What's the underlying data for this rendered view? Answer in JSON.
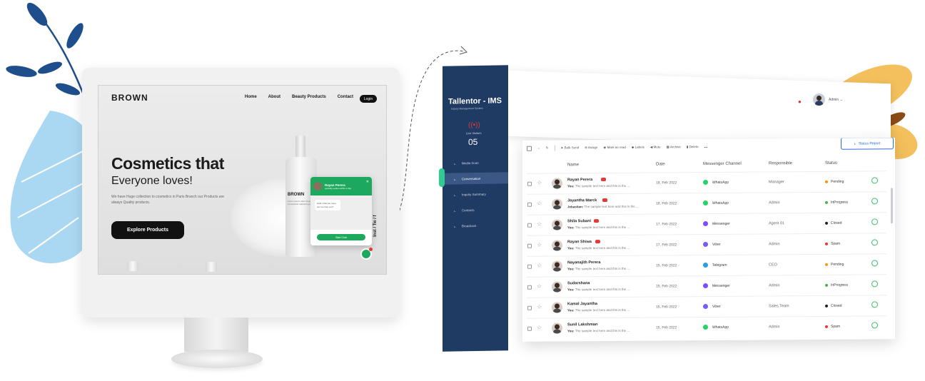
{
  "website": {
    "brand": "BROWN",
    "nav": [
      "Home",
      "About",
      "Beauty Products",
      "Contact"
    ],
    "login": "Login",
    "hero_title": "Cosmetics that",
    "hero_subtitle": "Everyone loves!",
    "hero_desc": "We have Huge collection to cosmetics in Paris Branch our Products are always Quality products.",
    "cta": "Explore Products",
    "bottle_label": "BROWN",
    "bottle_text": "Lorem ipsum dolor sit amet consectetur adipiscing elit",
    "chat": {
      "name": "Rayan Perera",
      "status": "typically replies within a day",
      "message": "Hello Channel, How can we help you?",
      "start": "Start Chat"
    },
    "social": "Inst / Tw / f"
  },
  "ims": {
    "brand": "Tallentor - IMS",
    "tagline": "Inquiry Management System",
    "live_label": "Live Visitors",
    "live_count": "05",
    "menu": [
      {
        "label": "Media Scan",
        "active": false
      },
      {
        "label": "Conversation",
        "active": true
      },
      {
        "label": "Inquiry Summary",
        "active": false
      },
      {
        "label": "Contacts",
        "active": false
      },
      {
        "label": "Broadcast",
        "active": false
      }
    ],
    "admin": "Admin",
    "toolbar": [
      "Bulk Send",
      "Assign",
      "Mark as read",
      "Labels",
      "Mute",
      "Archive",
      "Delete"
    ],
    "status_report": "Status Report",
    "columns": [
      "Name",
      "Date",
      "Messenger Channel",
      "Responsible",
      "Status"
    ],
    "rows": [
      {
        "name": "Rayan Perera",
        "badge": true,
        "sender": "You:",
        "msg": "The sample text here and this is the ...",
        "date": "18, Feb 2022",
        "channel": "WhatsApp",
        "channel_color": "#25d366",
        "responsible": "Manager",
        "status": "Pending",
        "status_color": "#ff9800"
      },
      {
        "name": "Jayantha Marck",
        "badge": true,
        "sender": "Jebastian:",
        "msg": "The sample text here and this is the ...",
        "date": "18, Feb 2022",
        "channel": "WhatsApp",
        "channel_color": "#25d366",
        "responsible": "Admin",
        "status": "InProgress",
        "status_color": "#4caf50"
      },
      {
        "name": "Shila Subani",
        "badge": true,
        "sender": "You:",
        "msg": "The sample text here and this is the ...",
        "date": "17, Feb 2022",
        "channel": "Messenger",
        "channel_color": "#7b4dff",
        "responsible": "Agent 01",
        "status": "Closed",
        "status_color": "#222222"
      },
      {
        "name": "Rayan Shiwa",
        "badge": true,
        "sender": "You:",
        "msg": "The sample text here and this is the ...",
        "date": "17, Feb 2022",
        "channel": "Viber",
        "channel_color": "#7360f2",
        "responsible": "Admin",
        "status": "Spam",
        "status_color": "#e53935"
      },
      {
        "name": "Nayanajith Perera",
        "badge": false,
        "sender": "You:",
        "msg": "The sample text here and this is the ...",
        "date": "15, Feb 2022",
        "channel": "Telegram",
        "channel_color": "#2aa1da",
        "responsible": "CEO",
        "status": "Pending",
        "status_color": "#ff9800"
      },
      {
        "name": "Sudarshana",
        "badge": false,
        "sender": "You:",
        "msg": "The sample text here and this is the ...",
        "date": "15, Feb 2022",
        "channel": "Messenger",
        "channel_color": "#7b4dff",
        "responsible": "Admin",
        "status": "InProgress",
        "status_color": "#4caf50"
      },
      {
        "name": "Kamal Jayantha",
        "badge": false,
        "sender": "You:",
        "msg": "The sample text here and this is the ...",
        "date": "15, Feb 2022",
        "channel": "Viber",
        "channel_color": "#7360f2",
        "responsible": "Sales Team",
        "status": "Closed",
        "status_color": "#222222"
      },
      {
        "name": "Sunil Lakshman",
        "badge": false,
        "sender": "You:",
        "msg": "The sample text here and this is the ...",
        "date": "15, Feb 2022",
        "channel": "WhatsApp",
        "channel_color": "#25d366",
        "responsible": "Admin",
        "status": "Spam",
        "status_color": "#e53935"
      }
    ]
  }
}
